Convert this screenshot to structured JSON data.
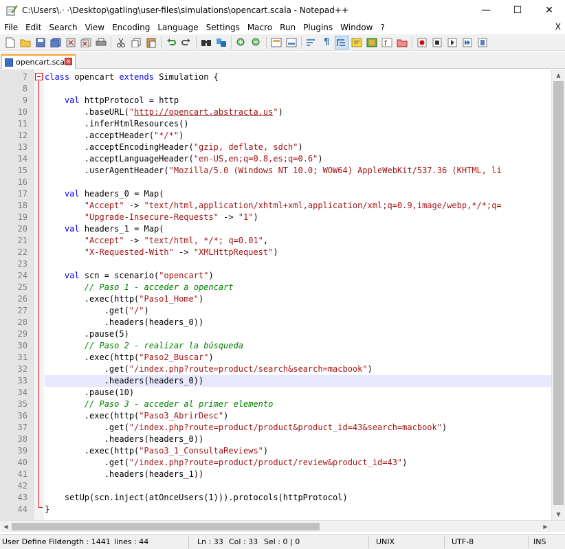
{
  "window": {
    "title": "C:\\Users\\.· ·\\Desktop\\gatling\\user-files\\simulations\\opencart.scala - Notepad++",
    "minimize": "—",
    "maximize": "☐",
    "close": "✕"
  },
  "menu": {
    "items": [
      "File",
      "Edit",
      "Search",
      "View",
      "Encoding",
      "Language",
      "Settings",
      "Macro",
      "Run",
      "Plugins",
      "Window",
      "?"
    ],
    "close_doc": "X"
  },
  "toolbar": {
    "icons": [
      "new-file-icon",
      "open-file-icon",
      "save-icon",
      "save-all-icon",
      "close-icon",
      "close-all-icon",
      "print-icon",
      "cut-icon",
      "copy-icon",
      "paste-icon",
      "undo-icon",
      "redo-icon",
      "find-icon",
      "replace-icon",
      "zoom-in-icon",
      "zoom-out-icon",
      "sync-vertical-icon",
      "sync-horizontal-icon",
      "word-wrap-icon",
      "show-all-chars-icon",
      "indent-guide-icon",
      "user-define-lang-icon",
      "doc-map-icon",
      "function-list-icon",
      "folder-workspace-icon",
      "record-macro-icon",
      "stop-macro-icon",
      "play-macro-icon",
      "run-macro-multiple-icon",
      "save-macro-icon"
    ]
  },
  "tab": {
    "label": "opencart.scala",
    "close": "x"
  },
  "editor": {
    "lines": [
      {
        "n": "7",
        "html": "<span class=\"kw\">class</span> opencart <span class=\"kw\">extends</span> Simulation {"
      },
      {
        "n": "8",
        "html": ""
      },
      {
        "n": "9",
        "html": "    <span class=\"kw\">val</span> httpProtocol = http"
      },
      {
        "n": "10",
        "html": "        .baseURL(<span class=\"str\">\"</span><span class=\"url\">http://opencart.abstracta.us</span><span class=\"str\">\"</span>)"
      },
      {
        "n": "11",
        "html": "        .inferHtmlResources()"
      },
      {
        "n": "12",
        "html": "        .acceptHeader(<span class=\"str\">\"*/*\"</span>)"
      },
      {
        "n": "13",
        "html": "        .acceptEncodingHeader(<span class=\"str\">\"gzip, deflate, sdch\"</span>)"
      },
      {
        "n": "14",
        "html": "        .acceptLanguageHeader(<span class=\"str\">\"en-US,en;q=0.8,es;q=0.6\"</span>)"
      },
      {
        "n": "15",
        "html": "        .userAgentHeader(<span class=\"str\">\"Mozilla/5.0 (Windows NT 10.0; WOW64) AppleWebKit/537.36 (KHTML, li</span>"
      },
      {
        "n": "16",
        "html": ""
      },
      {
        "n": "17",
        "html": "    <span class=\"kw\">val</span> headers_0 = Map("
      },
      {
        "n": "18",
        "html": "        <span class=\"str\">\"Accept\"</span> -&gt; <span class=\"str\">\"text/html,application/xhtml+xml,application/xml;q=0.9,image/webp,*/*;q=</span>"
      },
      {
        "n": "19",
        "html": "        <span class=\"str\">\"Upgrade-Insecure-Requests\"</span> -&gt; <span class=\"str\">\"1\"</span>)"
      },
      {
        "n": "20",
        "html": "    <span class=\"kw\">val</span> headers_1 = Map("
      },
      {
        "n": "21",
        "html": "        <span class=\"str\">\"Accept\"</span> -&gt; <span class=\"str\">\"text/html, */*; q=0.01\"</span>,"
      },
      {
        "n": "22",
        "html": "        <span class=\"str\">\"X-Requested-With\"</span> -&gt; <span class=\"str\">\"XMLHttpRequest\"</span>)"
      },
      {
        "n": "23",
        "html": ""
      },
      {
        "n": "24",
        "html": "    <span class=\"kw\">val</span> scn = scenario(<span class=\"str\">\"opencart\"</span>)"
      },
      {
        "n": "25",
        "html": "        <span class=\"cmt\">// Paso 1 - acceder a opencart</span>"
      },
      {
        "n": "26",
        "html": "        .exec(http(<span class=\"str\">\"Paso1_Home\"</span>)"
      },
      {
        "n": "27",
        "html": "            .get(<span class=\"str\">\"/\"</span>)"
      },
      {
        "n": "28",
        "html": "            .headers(headers_0))"
      },
      {
        "n": "29",
        "html": "        .pause(5)"
      },
      {
        "n": "30",
        "html": "        <span class=\"cmt\">// Paso 2 - realizar la búsqueda</span>"
      },
      {
        "n": "31",
        "html": "        .exec(http(<span class=\"str\">\"Paso2_Buscar\"</span>)"
      },
      {
        "n": "32",
        "html": "            .get(<span class=\"str\">\"/index.php?route=product/search&amp;search=macbook\"</span>)"
      },
      {
        "n": "33",
        "html": "            .headers(headers_0))",
        "current": true
      },
      {
        "n": "34",
        "html": "        .pause(10)"
      },
      {
        "n": "35",
        "html": "        <span class=\"cmt\">// Paso 3 - acceder al primer elemento</span>"
      },
      {
        "n": "36",
        "html": "        .exec(http(<span class=\"str\">\"Paso3_AbrirDesc\"</span>)"
      },
      {
        "n": "37",
        "html": "            .get(<span class=\"str\">\"/index.php?route=product/product&amp;product_id=43&amp;search=macbook\"</span>)"
      },
      {
        "n": "38",
        "html": "            .headers(headers_0))"
      },
      {
        "n": "39",
        "html": "        .exec(http(<span class=\"str\">\"Paso3_1_ConsultaReviews\"</span>)"
      },
      {
        "n": "40",
        "html": "            .get(<span class=\"str\">\"/index.php?route=product/product/review&amp;product_id=43\"</span>)"
      },
      {
        "n": "41",
        "html": "            .headers(headers_1))"
      },
      {
        "n": "42",
        "html": ""
      },
      {
        "n": "43",
        "html": "    setUp(scn.inject(atOnceUsers(1))).protocols(httpProtocol)"
      },
      {
        "n": "44",
        "html": "}"
      }
    ]
  },
  "status": {
    "lang": "User Define File",
    "length": "length : 1441",
    "lines": "lines : 44",
    "ln": "Ln : 33",
    "col": "Col : 33",
    "sel": "Sel : 0 | 0",
    "eol": "UNIX",
    "encoding": "UTF-8",
    "mode": "INS"
  },
  "colors": {
    "keyword": "#0000ff",
    "string": "#a31515",
    "comment": "#008000",
    "current_line": "#e8e8ff",
    "fold_marker": "#e00000",
    "tab_accent": "#f5a523"
  }
}
